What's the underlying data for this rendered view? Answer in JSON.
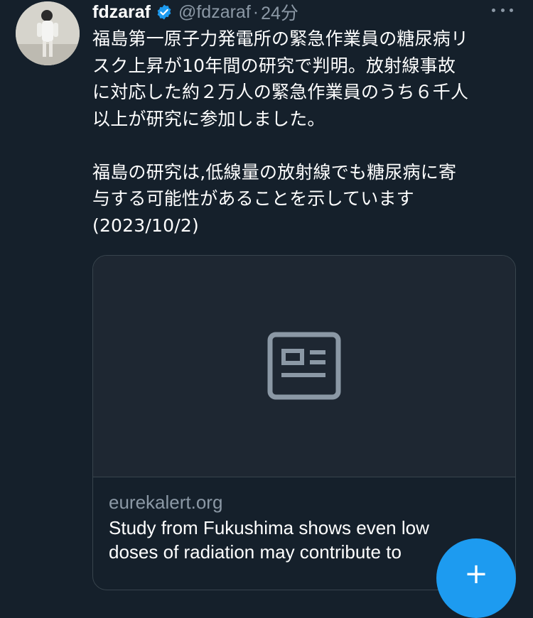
{
  "tweet": {
    "display_name": "fdzaraf",
    "handle": "@fdzaraf",
    "separator": "·",
    "time": "24分",
    "verified_icon": "verified-badge-icon",
    "more_icon": "more-dots-icon",
    "text_lines": [
      "福島第一原子力発電所の緊急作業員の糖尿病リ",
      "スク上昇が10年間の研究で判明。放射線事故",
      "に対応した約２万人の緊急作業員のうち６千人",
      "以上が研究に参加しました。",
      "福島の研究は,低線量の放射線でも糖尿病に寄",
      "与する可能性があることを示しています",
      "(2023/10/2)"
    ]
  },
  "card": {
    "media_icon": "news-article-icon",
    "domain": "eurekalert.org",
    "title_lines": [
      "Study from Fukushima shows even low",
      "doses of radiation may contribute to"
    ]
  },
  "compose_button": {
    "icon": "plus-icon",
    "label": "+"
  },
  "colors": {
    "background": "#15202b",
    "text_primary": "#ffffff",
    "text_secondary": "#8b98a5",
    "border": "#38444d",
    "accent": "#1d9bf0"
  }
}
